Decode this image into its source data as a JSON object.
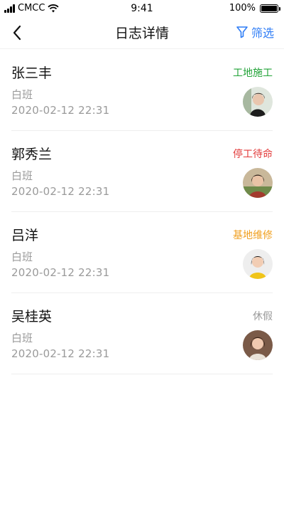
{
  "status_bar": {
    "carrier": "CMCC",
    "time": "9:41",
    "battery": "100%"
  },
  "nav": {
    "title": "日志详情",
    "filter_label": "筛选"
  },
  "colors": {
    "accent": "#2f7df6",
    "green": "#22a338",
    "red": "#e23b3b",
    "orange": "#f0a020",
    "gray": "#9a9a9a"
  },
  "items": [
    {
      "name": "张三丰",
      "shift": "白班",
      "time": "2020-02-12 22:31",
      "status": "工地施工",
      "status_color": "#22a338"
    },
    {
      "name": "郭秀兰",
      "shift": "白班",
      "time": "2020-02-12 22:31",
      "status": "停工待命",
      "status_color": "#e23b3b"
    },
    {
      "name": "吕洋",
      "shift": "白班",
      "time": "2020-02-12 22:31",
      "status": "基地维修",
      "status_color": "#f0a020"
    },
    {
      "name": "吴桂英",
      "shift": "白班",
      "time": "2020-02-12 22:31",
      "status": "休假",
      "status_color": "#9a9a9a"
    }
  ]
}
